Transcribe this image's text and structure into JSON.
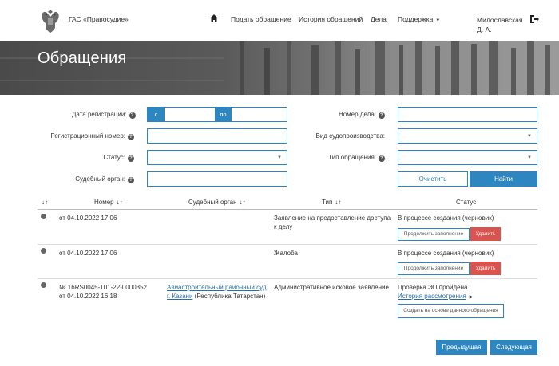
{
  "header": {
    "brand": "ГАС «Правосудие»",
    "nav": [
      {
        "label": "Подать обращение"
      },
      {
        "label": "История обращений"
      },
      {
        "label": "Дела"
      },
      {
        "label": "Поддержка"
      }
    ],
    "user_line1": "Милославская",
    "user_line2": "Д. А."
  },
  "banner": {
    "title": "Обращения"
  },
  "filters": {
    "reg_date_label": "Дата регистрации:",
    "date_from": "с",
    "date_to": "по",
    "reg_number_label": "Регистрационный номер:",
    "status_label": "Статус:",
    "court_label": "Судебный орган:",
    "case_number_label": "Номер дела:",
    "proceeding_label": "Вид судопроизводства:",
    "appeal_type_label": "Тип обращения:",
    "clear_label": "Очистить",
    "find_label": "Найти"
  },
  "table": {
    "columns": {
      "sort": "↓↑",
      "number": "Номер",
      "court": "Судебный орган",
      "type": "Тип",
      "status": "Статус"
    },
    "rows": [
      {
        "number": "",
        "date": "от 04.10.2022 17:06",
        "court_link": "",
        "court_region": "",
        "type_line1": "Заявление на предоставление доступа",
        "type_line2": "к делу",
        "status": "В процессе создания (черновик)",
        "continue_label": "Продолжить заполнение",
        "delete_label": "Удалить"
      },
      {
        "number": "",
        "date": "от 04.10.2022 17:06",
        "court_link": "",
        "court_region": "",
        "type_line1": "Жалоба",
        "type_line2": "",
        "status": "В процессе создания (черновик)",
        "continue_label": "Продолжить заполнение",
        "delete_label": "Удалить"
      },
      {
        "number": "№ 16RS0045-101-22-0000352",
        "date": "от 04.10.2022 16:18",
        "court_link_line1": "Авиастроительный районный суд",
        "court_link_line2": "г. Казани",
        "court_region": "(Республика Татарстан)",
        "type_line1": "Административное исковое заявление",
        "status": "Проверка ЭП пройдена",
        "history_label": "История рассмотрения",
        "create_label": "Создать на основе данного обращения"
      }
    ]
  },
  "pagination": {
    "prev_label": "Предыдущая",
    "next_label": "Следующая"
  },
  "colors": {
    "accent": "#2e86c1",
    "danger": "#d9534f",
    "link": "#2e6e9e"
  },
  "icons": [
    "emblem-icon",
    "home-icon",
    "logout-icon",
    "help-icon",
    "sort-icon",
    "chevron-down-icon",
    "status-dot-icon",
    "triangle-right-icon"
  ]
}
